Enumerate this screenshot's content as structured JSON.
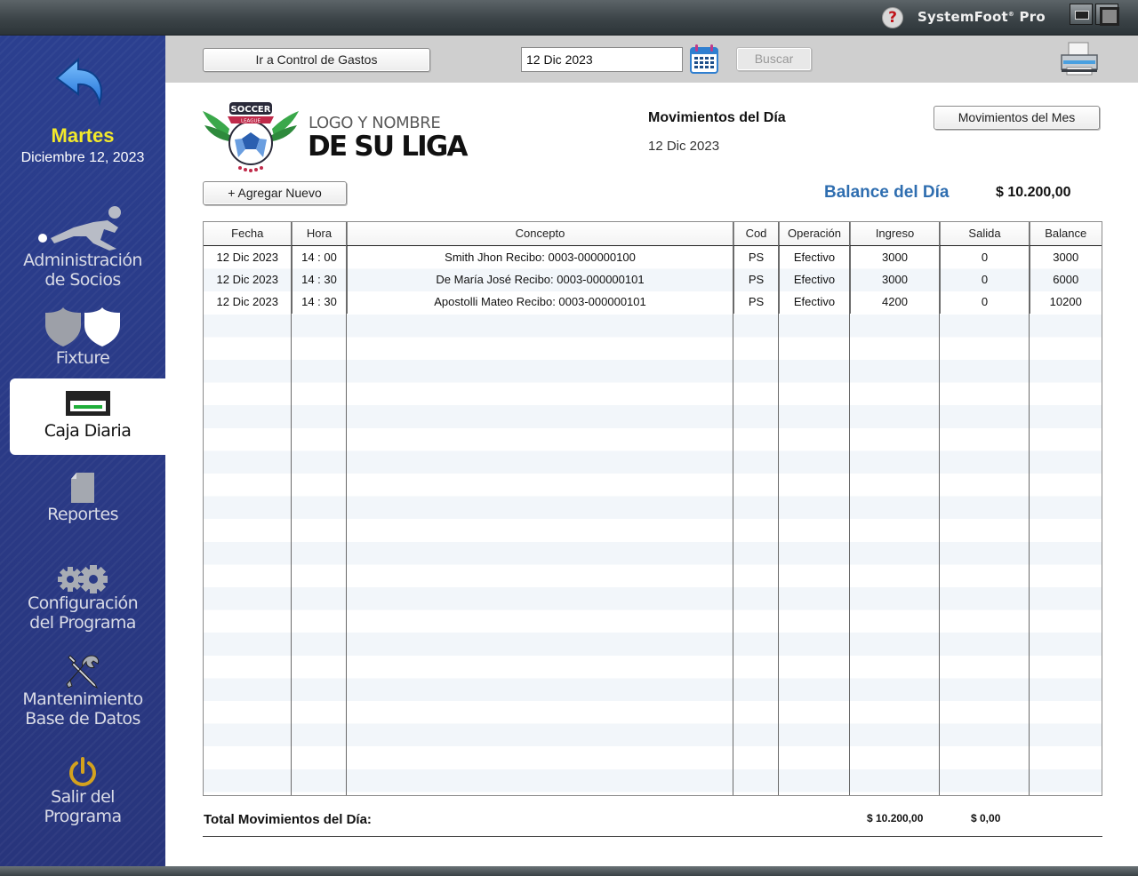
{
  "app": {
    "brand": "SystemFoot",
    "brand_mark": "®",
    "brand_suffix": "Pro",
    "help": "?"
  },
  "sidebar": {
    "day": "Martes",
    "date": "Diciembre 12, 2023",
    "items": [
      {
        "label": "Administración\nde Socios"
      },
      {
        "label": "Fixture"
      },
      {
        "label": "Caja Diaria"
      },
      {
        "label": "Reportes"
      },
      {
        "label": "Configuración\ndel Programa"
      },
      {
        "label": "Mantenimiento\nBase de Datos"
      },
      {
        "label": "Salir del\nPrograma"
      }
    ]
  },
  "toolbar": {
    "gastos_label": "Ir a Control de Gastos",
    "date_value": "12 Dic 2023",
    "search_label": "Buscar"
  },
  "header": {
    "logo_badge": "SOCCER",
    "logo_ribbon": "LEAGUE",
    "logo_line1": "LOGO Y NOMBRE",
    "logo_line2": "DE SU LIGA",
    "title": "Movimientos del Día",
    "date": "12 Dic 2023",
    "month_button": "Movimientos del Mes",
    "add_button": "+ Agregar Nuevo",
    "balance_label": "Balance del Día",
    "balance_value": "$ 10.200,00"
  },
  "table": {
    "columns": [
      "Fecha",
      "Hora",
      "Concepto",
      "Cod",
      "Operación",
      "Ingreso",
      "Salida",
      "Balance"
    ],
    "rows": [
      [
        "12 Dic 2023",
        "14 : 00",
        "Smith Jhon Recibo: 0003-000000100",
        "PS",
        "Efectivo",
        "3000",
        "0",
        "3000"
      ],
      [
        "12 Dic 2023",
        "14 : 30",
        "De María José Recibo: 0003-000000101",
        "PS",
        "Efectivo",
        "3000",
        "0",
        "6000"
      ],
      [
        "12 Dic 2023",
        "14 : 30",
        "Apostolli Mateo Recibo: 0003-000000101",
        "PS",
        "Efectivo",
        "4200",
        "0",
        "10200"
      ]
    ]
  },
  "totals": {
    "label": "Total Movimientos del Día:",
    "ingreso": "$ 10.200,00",
    "salida": "$ 0,00"
  },
  "colors": {
    "sidebar_bg": "#2b3f8f",
    "day_yellow": "#f3e92b",
    "balance_blue": "#2f6eb0"
  }
}
